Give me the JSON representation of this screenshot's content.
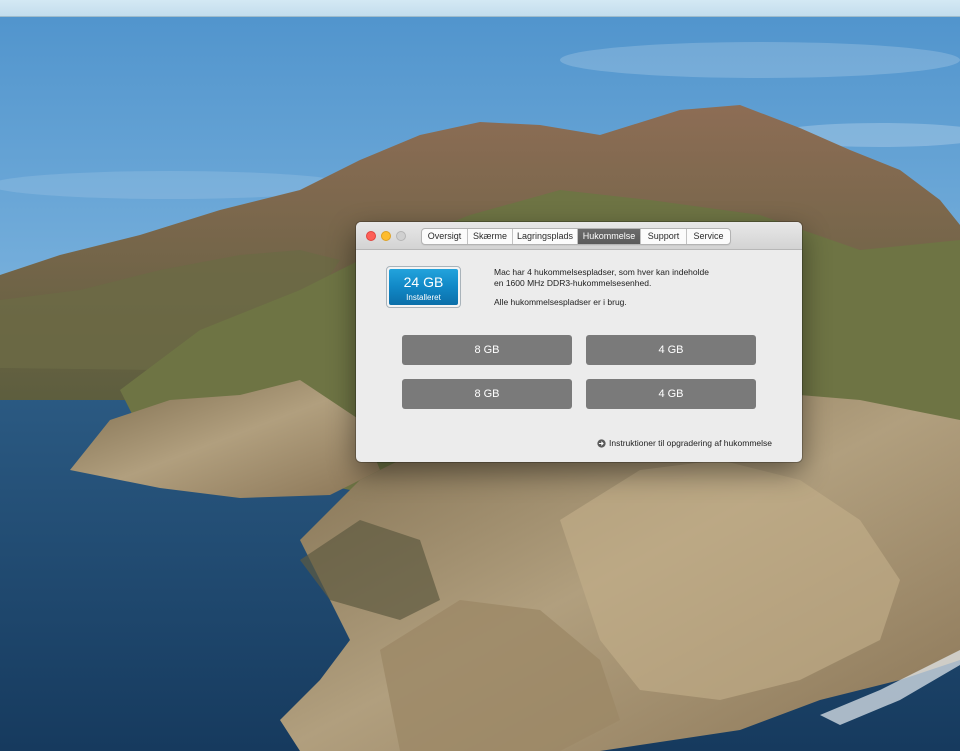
{
  "desktop": {
    "wallpaper": "macOS Catalina island landscape",
    "colors": {
      "sky_top": "#5e9fd3",
      "sky_bottom": "#a9cde6",
      "sea": "#244f78",
      "cliff": "#a68f6c"
    }
  },
  "window": {
    "traffic_lights": [
      "close",
      "minimize",
      "zoom"
    ],
    "tabs": [
      {
        "label": "Oversigt"
      },
      {
        "label": "Skærme"
      },
      {
        "label": "Lagringsplads"
      },
      {
        "label": "Hukommelse"
      },
      {
        "label": "Support"
      },
      {
        "label": "Service"
      }
    ],
    "active_tab": "Hukommelse",
    "memory": {
      "total": "24 GB",
      "label": "Installeret",
      "accent_color": "#1188c6"
    },
    "description_line1": "Mac har 4 hukommelsespladser, som hver kan indeholde",
    "description_line2": "en 1600 MHz DDR3-hukommelsesenhed.",
    "description_line3": "Alle hukommelsespladser er i brug.",
    "slots": [
      "8 GB",
      "4 GB",
      "8 GB",
      "4 GB"
    ],
    "upgrade_link": "Instruktioner til opgradering af hukommelse",
    "upgrade_icon": "arrow-circle-right-icon"
  }
}
